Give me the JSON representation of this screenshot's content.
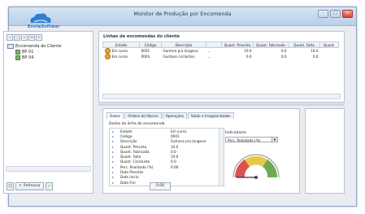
{
  "window": {
    "title": "Monitor de Produção por Encomenda",
    "btn_min": "–",
    "btn_max": "□",
    "btn_close": "×"
  },
  "logo": {
    "text": "EnviaSoftwar"
  },
  "left_panel": {
    "toolbar": [
      "≡",
      "□",
      "↔",
      "⊞",
      "⊟"
    ],
    "tree": {
      "root": "Encomenda do Cliente",
      "children": [
        "BP 01",
        "BP 04"
      ]
    },
    "refresh_label": "Refrescar",
    "ok_label": "✓"
  },
  "top_panel": {
    "title": "Linhas de encomendas do cliente",
    "columns": [
      "Estado",
      "Código",
      "Descrição",
      "Quant. Prevista",
      "Quant. Fabricada",
      "Quant. Falta",
      "Quant."
    ],
    "rows": [
      {
        "status": "Em curso",
        "code": "0001",
        "desc": "Gomera pra longeva",
        "ell": "...",
        "prevista": "10.0",
        "fabricada": "0.0",
        "falta": "10.0"
      },
      {
        "status": "Em curso",
        "code": "0003",
        "desc": "Gustavo circloritos",
        "ell": "...",
        "prevista": "0.0",
        "fabricada": "0.0",
        "falta": "0.0"
      }
    ]
  },
  "bottom_panel": {
    "tabs": [
      "Dados",
      "Ordens de fabrico",
      "Operações",
      "Saldo e Irregularidades"
    ],
    "details_title": "Dados da linha de encomenda",
    "details": [
      {
        "label": "Estado",
        "value": "Em curso"
      },
      {
        "label": "Código",
        "value": "0001"
      },
      {
        "label": "Descrição",
        "value": "Gomera pra longeva"
      },
      {
        "label": "Quant. Prevista",
        "value": "10.0"
      },
      {
        "label": "Quant. Fabricada",
        "value": "0.0"
      },
      {
        "label": "Quant. Falta",
        "value": "10.0"
      },
      {
        "label": "Quant. Concluída",
        "value": "0.0"
      },
      {
        "label": "Perc. Realizada (%)",
        "value": "0.00"
      },
      {
        "label": "Data Prevista",
        "value": ""
      },
      {
        "label": "Data Início",
        "value": ""
      },
      {
        "label": "Data Fim",
        "value": ""
      }
    ],
    "indicator_title": "Indicadores",
    "indicator_combo": "Perc. Realizada (%)",
    "gauge_value": "0.00",
    "gauge_level": 0,
    "colors": {
      "red": "#d9534f",
      "yellow": "#e8c84a",
      "green": "#6cab55"
    }
  }
}
